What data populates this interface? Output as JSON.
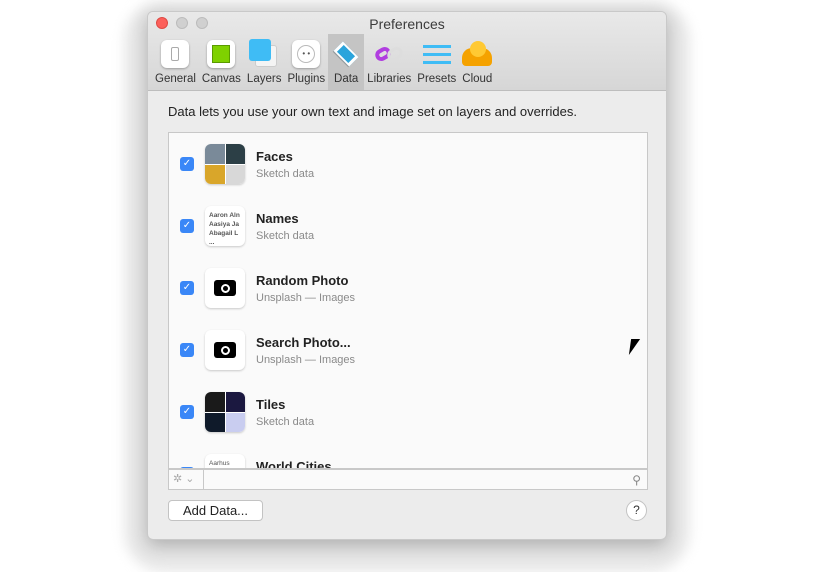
{
  "window": {
    "title": "Preferences"
  },
  "tabs": [
    {
      "label": "General",
      "icon": "toggle-icon"
    },
    {
      "label": "Canvas",
      "icon": "canvas-icon"
    },
    {
      "label": "Layers",
      "icon": "layers-icon"
    },
    {
      "label": "Plugins",
      "icon": "plug-icon"
    },
    {
      "label": "Data",
      "icon": "data-icon",
      "active": true
    },
    {
      "label": "Libraries",
      "icon": "link-icon"
    },
    {
      "label": "Presets",
      "icon": "sliders-icon"
    },
    {
      "label": "Cloud",
      "icon": "cloud-icon"
    }
  ],
  "description": "Data lets you use your own text and image set on layers and overrides.",
  "items": [
    {
      "name": "Faces",
      "source": "Sketch data",
      "checked": true
    },
    {
      "name": "Names",
      "source": "Sketch data",
      "checked": true,
      "preview": [
        "Aaron Aln",
        "Aasiya Ja",
        "Abagail L",
        "..."
      ]
    },
    {
      "name": "Random Photo",
      "source": "Unsplash — Images",
      "checked": true
    },
    {
      "name": "Search Photo...",
      "source": "Unsplash — Images",
      "checked": true
    },
    {
      "name": "Tiles",
      "source": "Sketch data",
      "checked": true
    },
    {
      "name": "World Cities",
      "source": "",
      "checked": true,
      "preview": [
        "Aarhus"
      ]
    }
  ],
  "add_button": "Add Data...",
  "help_button": "?",
  "accent": "#3a87f7"
}
